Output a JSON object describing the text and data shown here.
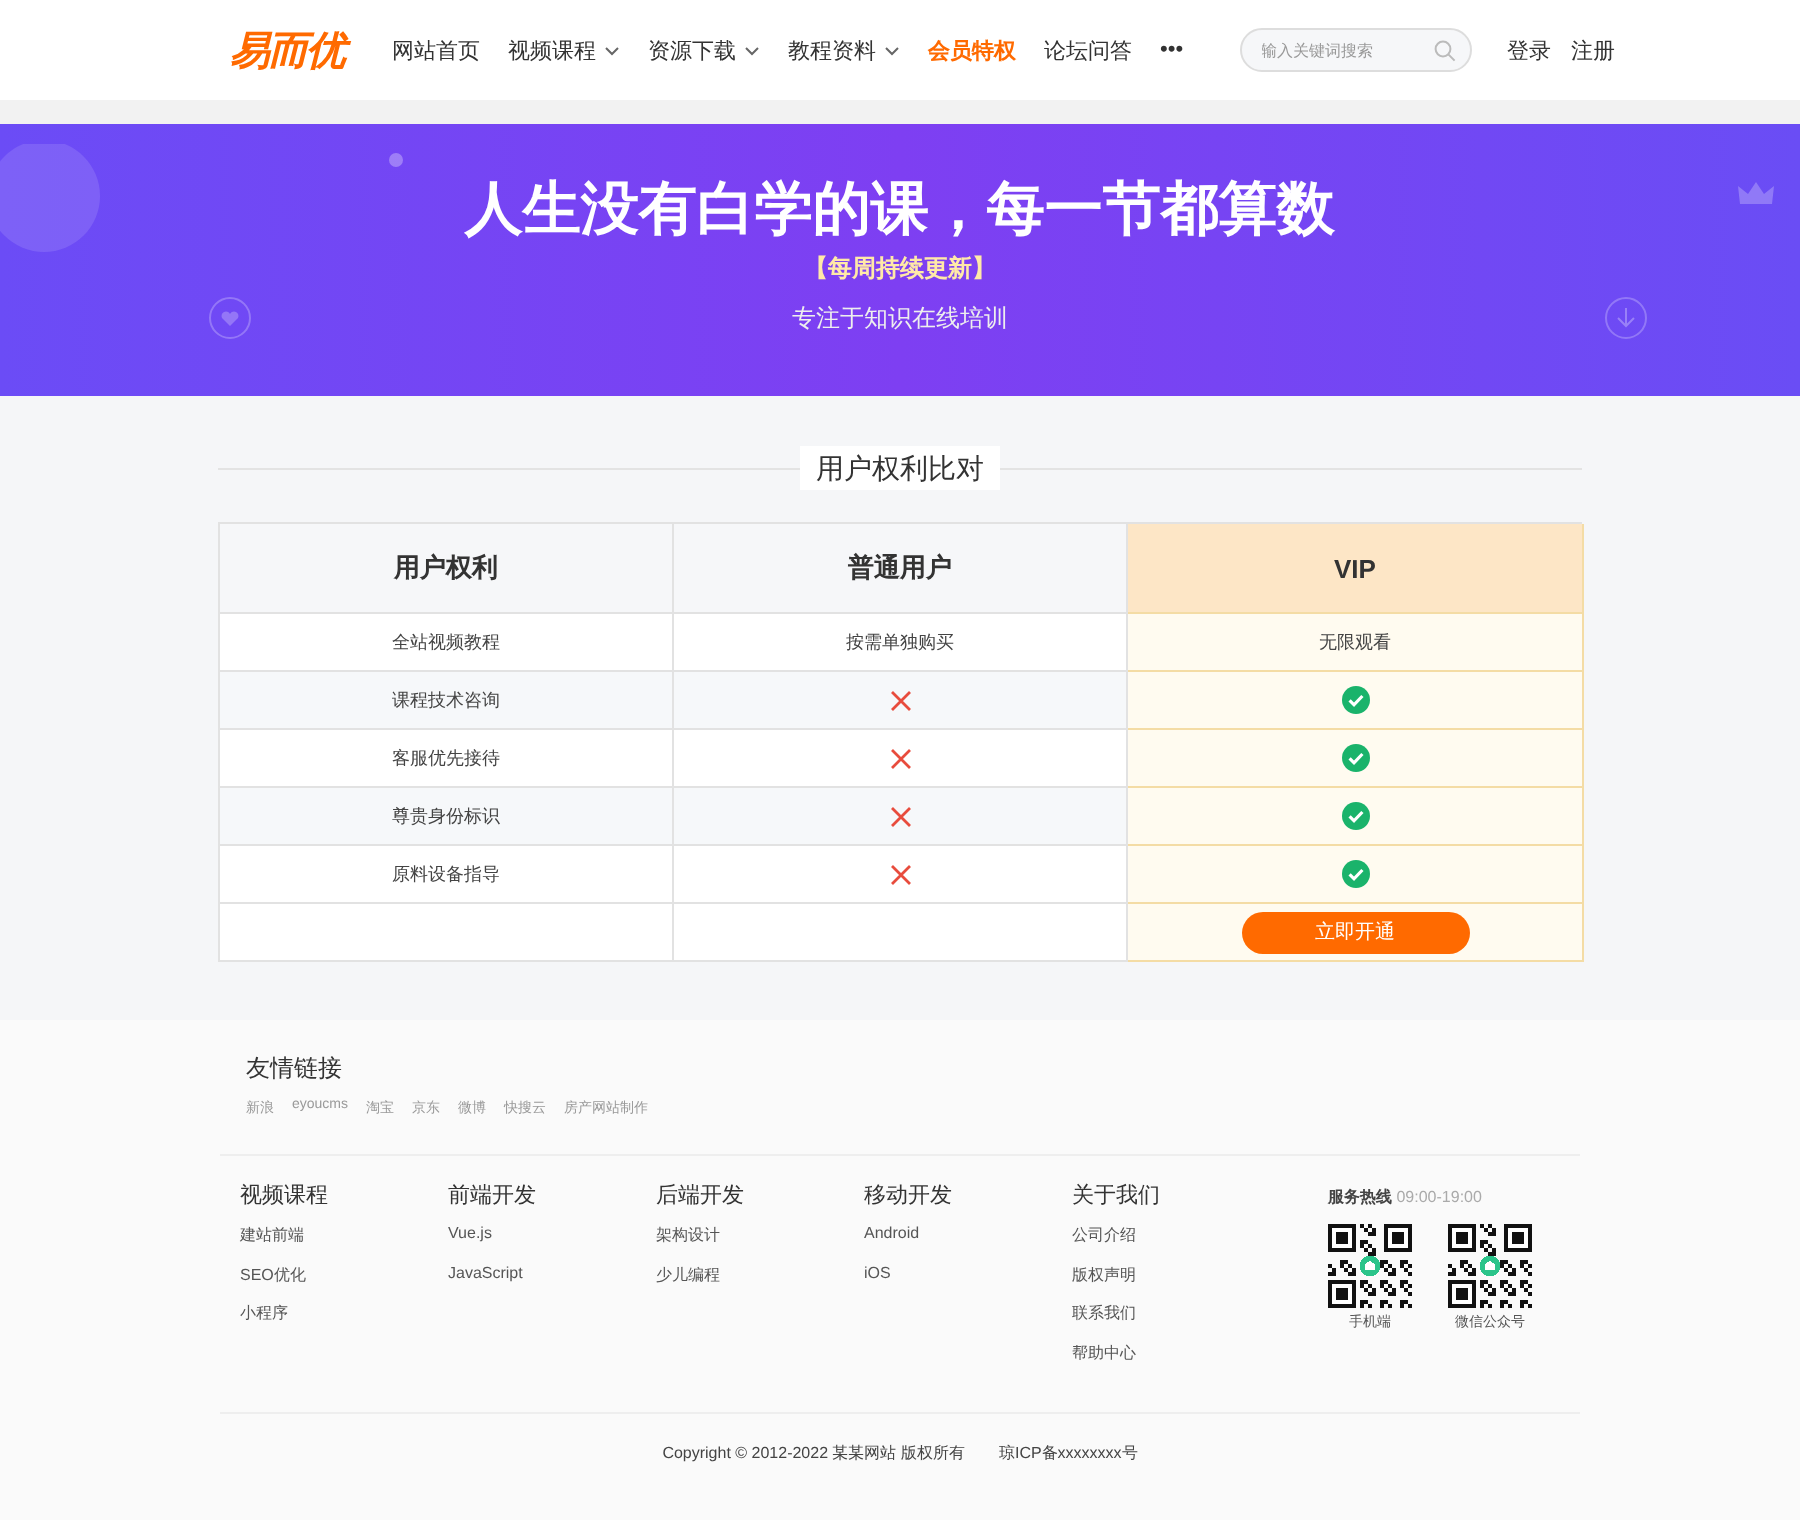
{
  "header": {
    "logo": "易而优",
    "nav": [
      {
        "label": "网站首页",
        "dropdown": false,
        "selected": false
      },
      {
        "label": "视频课程",
        "dropdown": true,
        "selected": false
      },
      {
        "label": "资源下载",
        "dropdown": true,
        "selected": false
      },
      {
        "label": "教程资料",
        "dropdown": true,
        "selected": false
      },
      {
        "label": "会员特权",
        "dropdown": false,
        "selected": true
      },
      {
        "label": "论坛问答",
        "dropdown": false,
        "selected": false
      },
      {
        "label": "•••",
        "dropdown": false,
        "selected": false
      }
    ],
    "search": {
      "placeholder": "输入关键词搜索"
    },
    "account": [
      "登录",
      "注册"
    ]
  },
  "banner": {
    "title": "人生没有白学的课，每一节都算数",
    "badge": "【每周持续更新】",
    "subtitle": "专注于知识在线培训"
  },
  "comparison": {
    "title": "用户权利比对",
    "columns": [
      "用户权利",
      "普通用户",
      "VIP"
    ],
    "rows": [
      {
        "feature": "全站视频教程",
        "normal": {
          "kind": "text",
          "text": "按需单独购买"
        },
        "vip": {
          "kind": "text",
          "text": "无限观看"
        }
      },
      {
        "feature": "课程技术咨询",
        "normal": {
          "kind": "mark",
          "included": false
        },
        "vip": {
          "kind": "mark",
          "included": true
        }
      },
      {
        "feature": "客服优先接待",
        "normal": {
          "kind": "mark",
          "included": false
        },
        "vip": {
          "kind": "mark",
          "included": true
        }
      },
      {
        "feature": "尊贵身份标识",
        "normal": {
          "kind": "mark",
          "included": false
        },
        "vip": {
          "kind": "mark",
          "included": true
        }
      },
      {
        "feature": "原料设备指导",
        "normal": {
          "kind": "mark",
          "included": false
        },
        "vip": {
          "kind": "mark",
          "included": true
        }
      }
    ],
    "action": "立即开通"
  },
  "footer": {
    "links_title": "友情链接",
    "links": [
      "新浪",
      "eyoucms",
      "淘宝",
      "京东",
      "微博",
      "快搜云",
      "房产网站制作"
    ],
    "columns": [
      {
        "title": "视频课程",
        "items": [
          "建站前端",
          "SEO优化",
          "小程序"
        ]
      },
      {
        "title": "前端开发",
        "items": [
          "Vue.js",
          "JavaScript"
        ]
      },
      {
        "title": "后端开发",
        "items": [
          "架构设计",
          "少儿编程"
        ]
      },
      {
        "title": "移动开发",
        "items": [
          "Android",
          "iOS"
        ]
      },
      {
        "title": "关于我们",
        "items": [
          "公司介绍",
          "版权声明",
          "联系我们",
          "帮助中心"
        ]
      }
    ],
    "hotline_label": "服务热线",
    "hotline_hours": "09:00-19:00",
    "qr_codes": [
      "手机端",
      "微信公众号"
    ],
    "copyright": "Copyright © 2012-2022 某某网站 版权所有",
    "icp": "琼ICP备xxxxxxxx号"
  }
}
